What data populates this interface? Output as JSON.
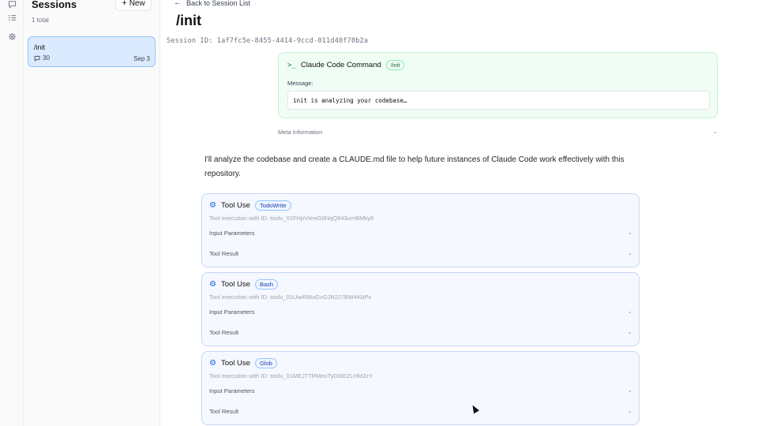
{
  "rail": {
    "icons": [
      "chat-icon",
      "list-icon",
      "gear-icon"
    ]
  },
  "sidebar": {
    "title": "Sessions",
    "new_label": "New",
    "count": "1 total",
    "session": {
      "title": "/init",
      "messages": "30",
      "date": "Sep 3"
    }
  },
  "header": {
    "back_label": "Back to Session List",
    "title": "/init",
    "session_id": "Session ID: 1af7fc5e-8455-4414-9ccd-011d40f70b2a"
  },
  "command": {
    "title": "Claude Code Command",
    "badge": "/init",
    "message_label": "Message:",
    "message": "init is analyzing your codebase…",
    "meta_label": "Meta Information"
  },
  "assistant": {
    "text": "I'll analyze the codebase and create a CLAUDE.md file to help future instances of Claude Code work effectively with this repository."
  },
  "tools": [
    {
      "title": "Tool Use",
      "badge": "TodoWrite",
      "exec": "Tool execution with ID: toolu_01FHpVtewG6NqQ943umBMky8",
      "params": "Input Parameters",
      "result": "Tool Result"
    },
    {
      "title": "Tool Use",
      "badge": "Bash",
      "exec": "Tool execution with ID: toolu_01UwiR8tuGvGJN2J7BW4KbPx",
      "params": "Input Parameters",
      "result": "Tool Result"
    },
    {
      "title": "Tool Use",
      "badge": "Glob",
      "exec": "Tool execution with ID: toolu_01MEJ7TRMeoTyDi6EZLHM2zY",
      "params": "Input Parameters",
      "result": "Tool Result"
    }
  ]
}
